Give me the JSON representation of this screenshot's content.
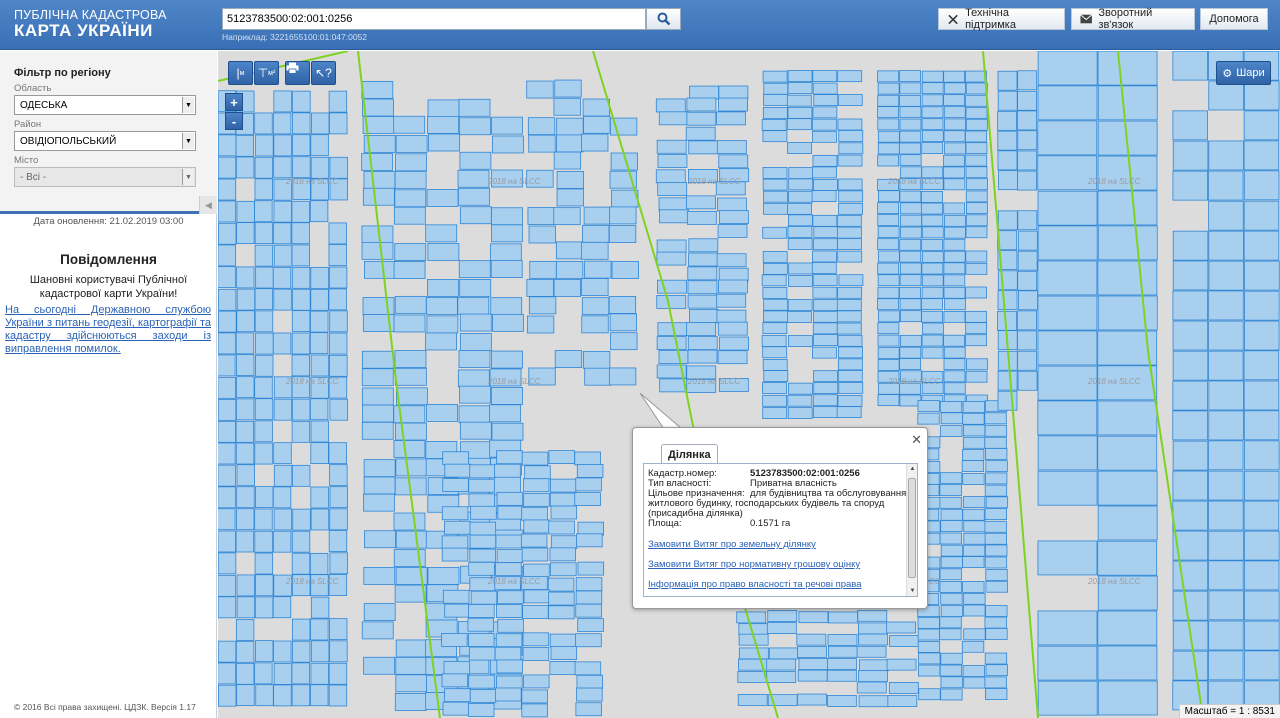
{
  "header": {
    "logo_line1": "ПУБЛІЧНА КАДАСТРОВА",
    "logo_line2": "КАРТА УКРАЇНИ",
    "search_value": "5123783500:02:001:0256",
    "example": "Наприклад: 3221655100:01:047:0052",
    "support_label": "Технічна підтримка",
    "feedback_label": "Зворотний зв'язок",
    "help_label": "Допомога"
  },
  "filter": {
    "title": "Фільтр по регіону",
    "region_label": "Область",
    "region_value": "ОДЕСЬКА",
    "district_label": "Район",
    "district_value": "ОВІДІОПОЛЬСЬКИЙ",
    "city_label": "Місто",
    "city_value": "- Всі -"
  },
  "sidebar": {
    "updated": "Дата оновлення: 21.02.2019 03:00",
    "notice_title": "Повідомлення",
    "notice_text": "Шановні користувачі Публічної кадастрової карти України!",
    "notice_link": "На сьогодні Державною службою України з питань геодезії, картографії та кадастру здійснюються заходи із виправлення помилок.",
    "copyright": "© 2016 Всі права захищені. ЦДЗК. Версія 1.17"
  },
  "map": {
    "layers_label": "Шари",
    "watermark": "2018 на SLCC",
    "scale": "Масштаб = 1 : 8531",
    "tool_measure_label": "м",
    "tool_area_label": "м²",
    "zoom_in": "+",
    "zoom_out": "-"
  },
  "popup": {
    "tab": "Ділянка",
    "rows": [
      {
        "key": "Кадастр.номер:",
        "value": "5123783500:02:001:0256"
      },
      {
        "key": "Тип власності:",
        "value": "Приватна власність"
      },
      {
        "key": "Цільове призначення:",
        "value": "для будівництва та обслуговування житлового будинку, господарських будівель та споруд (присадибна ділянка)"
      },
      {
        "key": "Площа:",
        "value": "0.1571 га"
      }
    ],
    "links": [
      "Замовити Витяг про земельну ділянку",
      "Замовити Витяг про нормативну грошову оцінку",
      "Інформація про право власності та речові права"
    ]
  },
  "colors": {
    "header": "#3f76bb",
    "parcel_fill": "#a9cfee",
    "parcel_stroke": "#2e86d6",
    "road_line": "#7ed321",
    "link": "#2a62b5"
  }
}
